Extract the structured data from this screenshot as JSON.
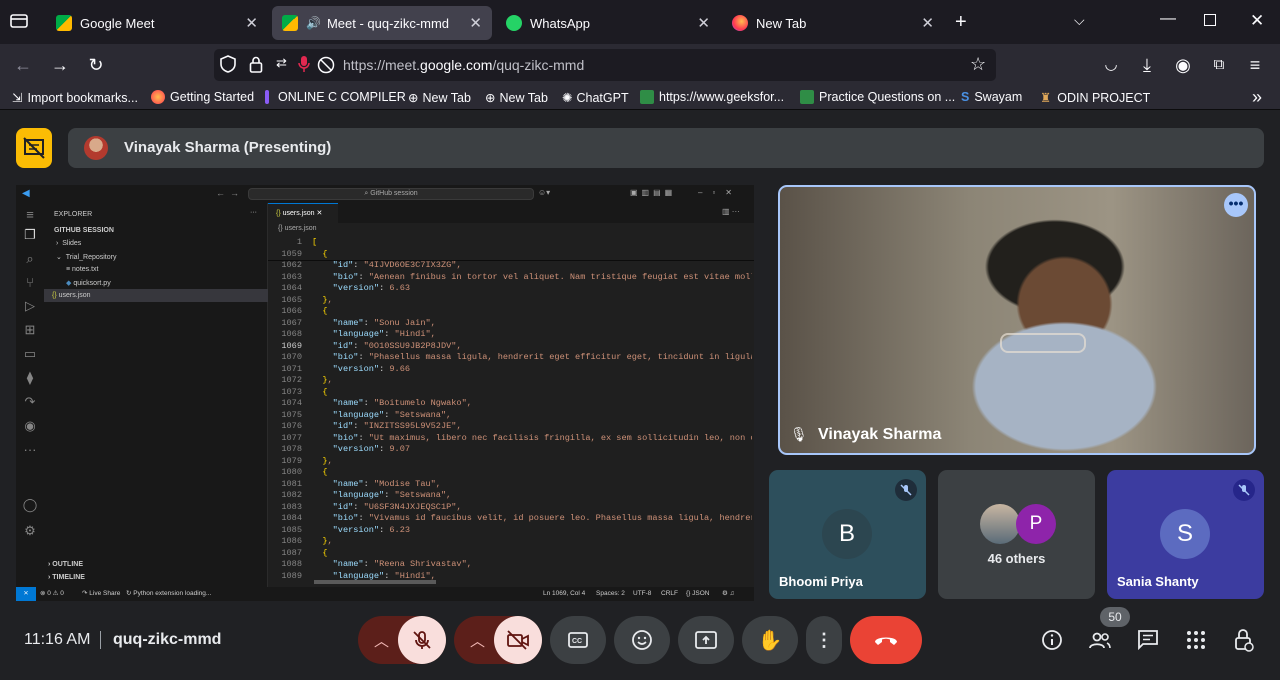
{
  "browser": {
    "tabs": [
      {
        "title": "Google Meet",
        "active": false
      },
      {
        "title": "Meet - quq-zikc-mmd",
        "active": true
      },
      {
        "title": "WhatsApp",
        "active": false
      },
      {
        "title": "New Tab",
        "active": false
      }
    ],
    "url_prefix": "https://meet.",
    "url_domain": "google.com",
    "url_path": "/quq-zikc-mmd",
    "bookmarks": [
      "Import bookmarks...",
      "Getting Started",
      "ONLINE C COMPILER",
      "New Tab",
      "New Tab",
      "ChatGPT",
      "https://www.geeksfor...",
      "Practice Questions on ...",
      "Swayam",
      "ODIN PROJECT"
    ]
  },
  "meet": {
    "presenter_label": "Vinayak Sharma (Presenting)",
    "main_participant": "Vinayak Sharma",
    "tiles": [
      {
        "initial": "B",
        "name": "Bhoomi Priya",
        "muted": true
      },
      {
        "initial": "P",
        "label": "46 others"
      },
      {
        "initial": "S",
        "name": "Sania Shanty",
        "muted": true
      }
    ],
    "time": "11:16 AM",
    "meeting_code": "quq-zikc-mmd",
    "participant_count": "50",
    "colors": {
      "end_call": "#ea4335",
      "presenting": "#fbbc04",
      "tile_b": "#2d4f5c",
      "tile_s": "#3c3ca0"
    }
  },
  "vscode": {
    "search": "GitHub session",
    "explorer_title": "EXPLORER",
    "session": "GITHUB SESSION",
    "tree": [
      "Slides",
      "Trial_Repository",
      "notes.txt",
      "quicksort.py",
      "users.json"
    ],
    "tab": "users.json",
    "breadcrumb": "{} users.json",
    "outline": "OUTLINE",
    "timeline": "TIMELINE",
    "status_left": "⊗ 0 ⚠ 0",
    "live_share": "Live Share",
    "python_status": "Python extension loading...",
    "status_right": [
      "Ln 1069, Col 4",
      "Spaces: 2",
      "UTF-8",
      "CRLF",
      "{} JSON"
    ],
    "lines": [
      {
        "n": "1",
        "t": "["
      },
      {
        "n": "1059",
        "t": "  {"
      },
      {
        "n": "1062",
        "t": "    \"id\": \"4IJVD6OE3C7IX3ZG\","
      },
      {
        "n": "1063",
        "t": "    \"bio\": \"Aenean finibus in tortor vel aliquet. Nam tristique feugiat est vitae mollis.\""
      },
      {
        "n": "1064",
        "t": "    \"version\": 6.63"
      },
      {
        "n": "1065",
        "t": "  },"
      },
      {
        "n": "1066",
        "t": "  {"
      },
      {
        "n": "1067",
        "t": "    \"name\": \"Sonu Jain\","
      },
      {
        "n": "1068",
        "t": "    \"language\": \"Hindi\","
      },
      {
        "n": "1069",
        "t": "    \"id\": \"0O10SSU9JB2P8JDV\","
      },
      {
        "n": "1070",
        "t": "    \"bio\": \"Phasellus massa ligula, hendrerit eget efficitur eget, tincidunt in ligula. Cu"
      },
      {
        "n": "1071",
        "t": "    \"version\": 9.66"
      },
      {
        "n": "1072",
        "t": "  },"
      },
      {
        "n": "1073",
        "t": "  {"
      },
      {
        "n": "1074",
        "t": "    \"name\": \"Boitumelo Ngwako\","
      },
      {
        "n": "1075",
        "t": "    \"language\": \"Setswana\","
      },
      {
        "n": "1076",
        "t": "    \"id\": \"INZITSS95L9V52JE\","
      },
      {
        "n": "1077",
        "t": "    \"bio\": \"Ut maximus, libero nec facilisis fringilla, ex sem sollicitudin leo, non congue"
      },
      {
        "n": "1078",
        "t": "    \"version\": 9.07"
      },
      {
        "n": "1079",
        "t": "  },"
      },
      {
        "n": "1080",
        "t": "  {"
      },
      {
        "n": "1081",
        "t": "    \"name\": \"Modise Tau\","
      },
      {
        "n": "1082",
        "t": "    \"language\": \"Setswana\","
      },
      {
        "n": "1083",
        "t": "    \"id\": \"U6SF3N4JXJEQSC1P\","
      },
      {
        "n": "1084",
        "t": "    \"bio\": \"Vivamus id faucibus velit, id posuere leo. Phasellus massa ligula, hendrerit eg"
      },
      {
        "n": "1085",
        "t": "    \"version\": 6.23"
      },
      {
        "n": "1086",
        "t": "  },"
      },
      {
        "n": "1087",
        "t": "  {"
      },
      {
        "n": "1088",
        "t": "    \"name\": \"Reena Shrivastav\","
      },
      {
        "n": "1089",
        "t": "    \"language\": \"Hindi\","
      }
    ]
  }
}
